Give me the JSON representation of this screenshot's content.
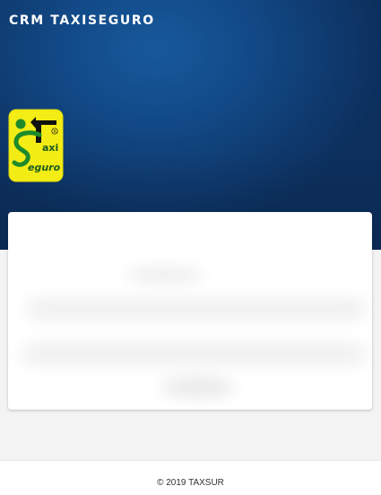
{
  "header": {
    "app_title": "CRM TAXISEGURO"
  },
  "logo": {
    "brand_text": "Taxi Seguro",
    "registered_mark": "®",
    "colors": {
      "background": "#f3ec15",
      "green": "#1e8a2a",
      "black": "#111111",
      "dark_green": "#1a5d1f"
    }
  },
  "login_card": {
    "state": "blurred"
  },
  "footer": {
    "copyright": "© 2019 TAXSUR"
  },
  "colors": {
    "header_blue": "#124a88",
    "page_background": "#f3f3f3"
  }
}
